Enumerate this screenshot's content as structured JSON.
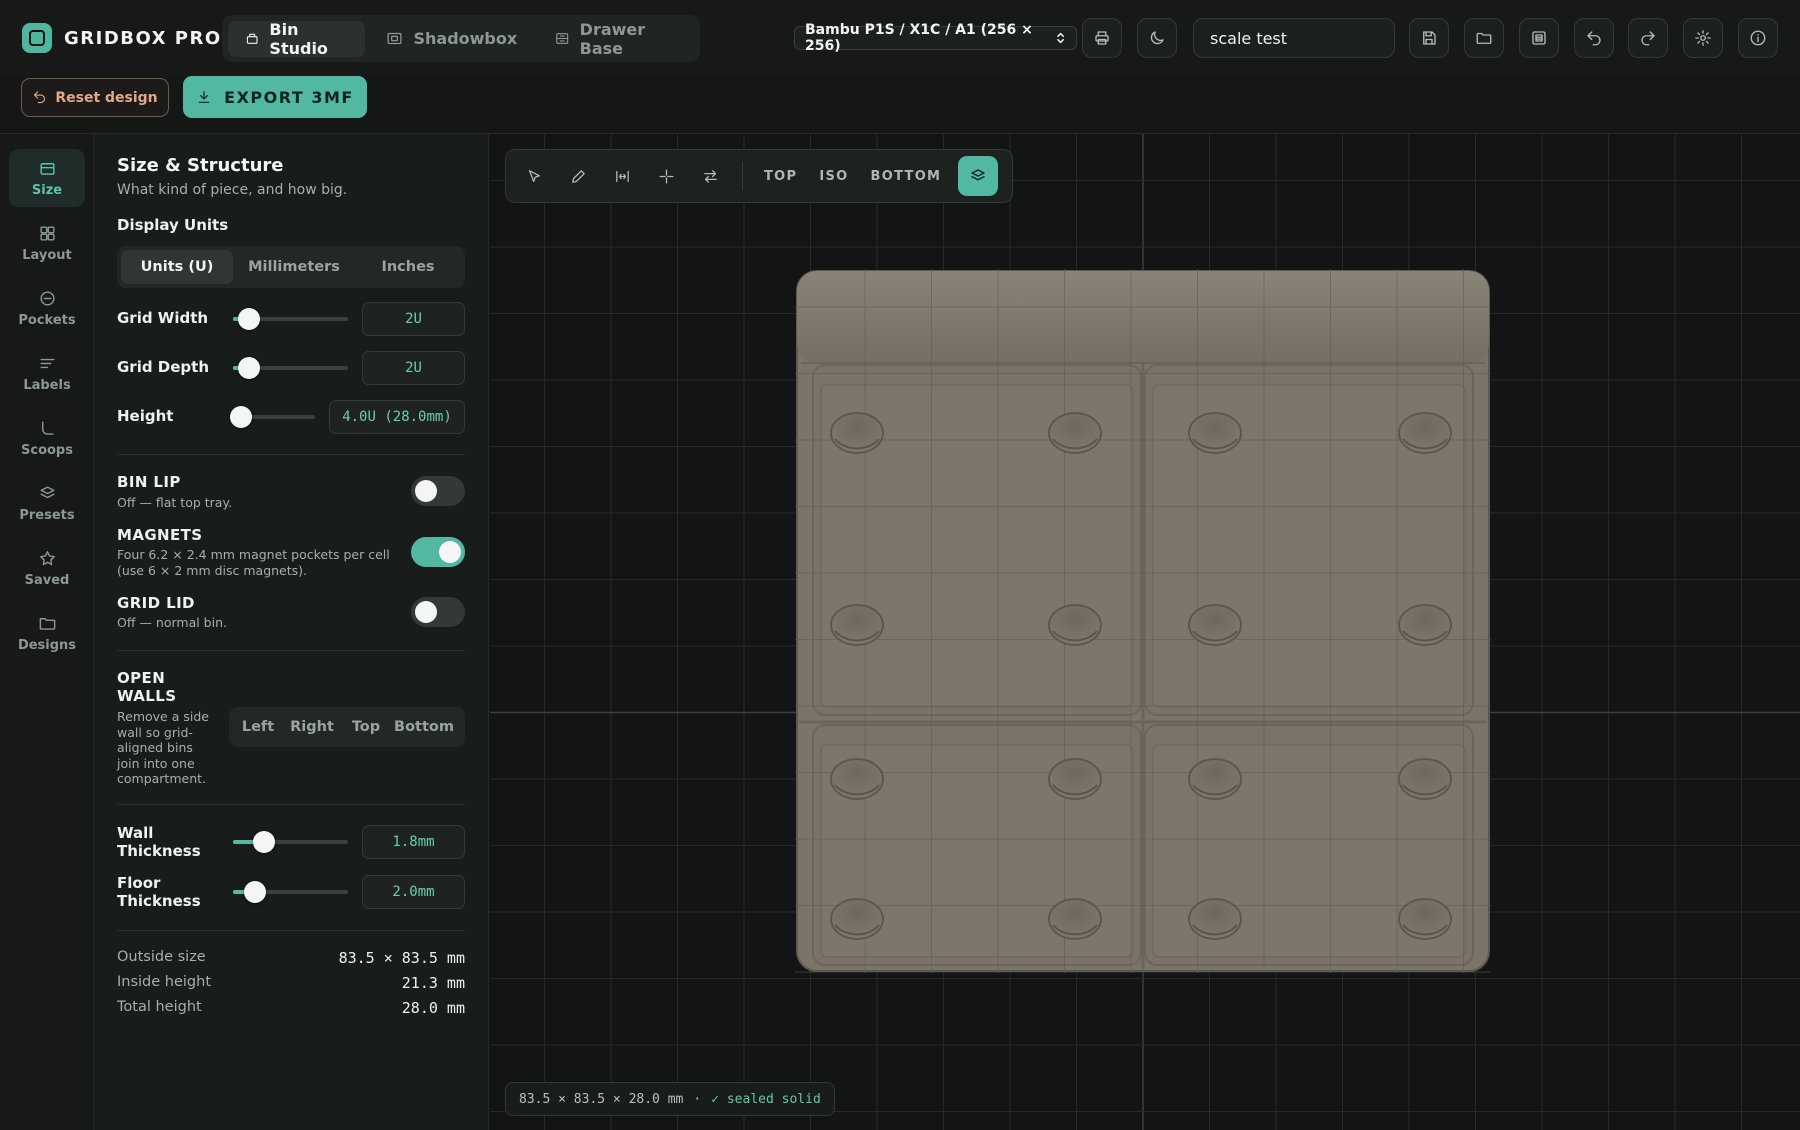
{
  "app": {
    "name": "GRIDBOX PRO"
  },
  "mode_tabs": [
    {
      "label": "Bin Studio",
      "icon": "box-icon",
      "active": true
    },
    {
      "label": "Shadowbox",
      "icon": "image-frame-icon",
      "active": false
    },
    {
      "label": "Drawer Base",
      "icon": "drawer-icon",
      "active": false
    }
  ],
  "printer": {
    "selected": "Bambu P1S / X1C / A1 (256 × 256)"
  },
  "design_name": {
    "value": "scale test"
  },
  "actions": {
    "reset": "Reset design",
    "export": "EXPORT 3MF"
  },
  "nav": [
    {
      "label": "Size",
      "icon": "size-icon",
      "active": true
    },
    {
      "label": "Layout",
      "icon": "layout-grid-icon"
    },
    {
      "label": "Pockets",
      "icon": "pocket-icon"
    },
    {
      "label": "Labels",
      "icon": "labels-icon"
    },
    {
      "label": "Scoops",
      "icon": "scoop-icon"
    },
    {
      "label": "Presets",
      "icon": "presets-icon"
    },
    {
      "label": "Saved",
      "icon": "star-icon"
    },
    {
      "label": "Designs",
      "icon": "folder-icon"
    }
  ],
  "panel": {
    "title": "Size & Structure",
    "subtitle": "What kind of piece, and how big.",
    "display_units": {
      "label": "Display Units",
      "options": [
        "Units (U)",
        "Millimeters",
        "Inches"
      ],
      "selected": "Units (U)"
    },
    "grid_width": {
      "label": "Grid Width",
      "value": "2U",
      "level": 0.14
    },
    "grid_depth": {
      "label": "Grid Depth",
      "value": "2U",
      "level": 0.14
    },
    "height": {
      "label": "Height",
      "value": "4.0U (28.0mm)",
      "level": 0.1
    },
    "bin_lip": {
      "label": "BIN LIP",
      "desc": "Off — flat top tray.",
      "on": false
    },
    "magnets": {
      "label": "MAGNETS",
      "desc": "Four 6.2 × 2.4 mm magnet pockets per cell (use 6 × 2 mm disc magnets).",
      "on": true
    },
    "grid_lid": {
      "label": "GRID LID",
      "desc": "Off — normal bin.",
      "on": false
    },
    "open_walls": {
      "label": "OPEN WALLS",
      "desc": "Remove a side wall so grid-aligned bins join into one compartment.",
      "options": [
        "Left",
        "Right",
        "Top",
        "Bottom"
      ]
    },
    "wall_thickness": {
      "label": "Wall Thickness",
      "value": "1.8mm",
      "level": 0.27
    },
    "floor_thickness": {
      "label": "Floor Thickness",
      "value": "2.0mm",
      "level": 0.19
    },
    "stats": [
      {
        "label": "Outside size",
        "value": "83.5 × 83.5 mm"
      },
      {
        "label": "Inside height",
        "value": "21.3 mm"
      },
      {
        "label": "Total height",
        "value": "28.0 mm"
      }
    ]
  },
  "viewport": {
    "views": [
      "TOP",
      "ISO",
      "BOTTOM"
    ],
    "tools": [
      "select-arrow-icon",
      "pencil-icon",
      "measure-icon",
      "crosshair-icon",
      "swap-icon"
    ],
    "status": {
      "dims": "83.5 × 83.5 × 28.0 mm",
      "sep": "·",
      "state": "✓ sealed solid"
    }
  },
  "colors": {
    "accent": "#52b8a1",
    "bin": "#7b7469",
    "background": "#121514",
    "reset": "#e1a98a"
  }
}
